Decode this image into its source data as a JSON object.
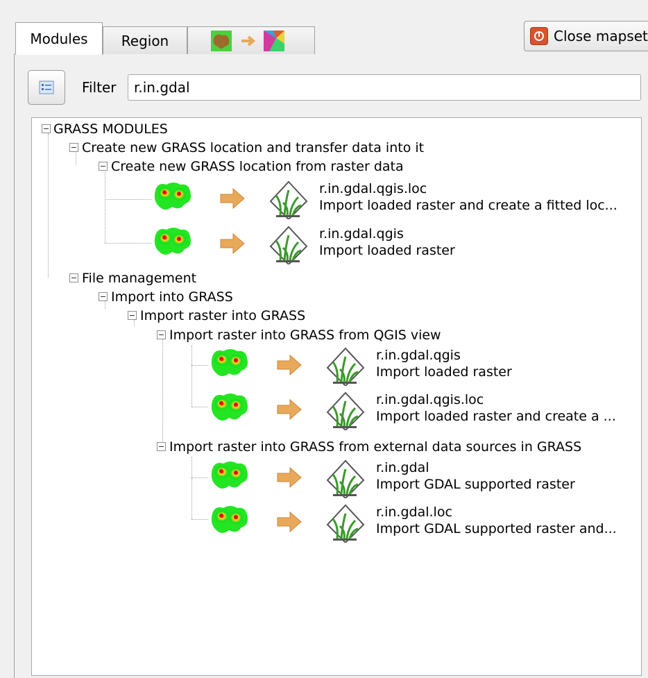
{
  "tabs": [
    {
      "label": "Modules",
      "active": true
    },
    {
      "label": "Region",
      "active": false
    },
    {
      "label": "",
      "icon": "raster-to-vector-conversion-icon",
      "active": false
    }
  ],
  "close_button": {
    "label": "Close mapset",
    "icon": "close-mapset-icon"
  },
  "filter": {
    "label": "Filter",
    "value": "r.in.gdal",
    "button_icon": "filter-mode-icon"
  },
  "tree": {
    "root": "GRASS MODULES",
    "groups": {
      "create_location": "Create new GRASS location and transfer data into it",
      "from_raster": "Create new GRASS location from raster data",
      "file_management": "File management",
      "import_into_grass": "Import into GRASS",
      "import_raster": "Import raster into GRASS",
      "from_qgis_view": "Import raster into GRASS from QGIS view",
      "from_external": "Import raster into GRASS from external data sources in GRASS"
    },
    "modules": [
      {
        "name": "r.in.gdal.qgis.loc",
        "desc": "Import loaded raster and create a fitted loc..."
      },
      {
        "name": "r.in.gdal.qgis",
        "desc": "Import loaded raster"
      },
      {
        "name": "r.in.gdal.qgis",
        "desc": "Import loaded raster"
      },
      {
        "name": "r.in.gdal.qgis.loc",
        "desc": "Import loaded raster and create a ..."
      },
      {
        "name": "r.in.gdal",
        "desc": "Import GDAL supported raster"
      },
      {
        "name": "r.in.gdal.loc",
        "desc": "Import GDAL supported raster and..."
      }
    ]
  },
  "colors": {
    "arrow": "#e8a95a",
    "blob_green": "#22e622",
    "grass_icon": "#3a9a2a",
    "close_red": "#d9532c"
  }
}
